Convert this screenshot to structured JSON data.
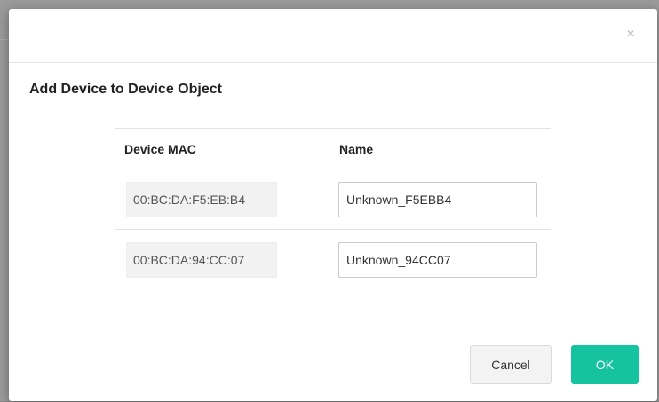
{
  "dialog": {
    "title": "Add Device to Device Object",
    "close_glyph": "×",
    "close_icon": "close-icon"
  },
  "table": {
    "headers": [
      "Device MAC",
      "Name"
    ],
    "rows": [
      {
        "mac": "00:BC:DA:F5:EB:B4",
        "name": "Unknown_F5EBB4"
      },
      {
        "mac": "00:BC:DA:94:CC:07",
        "name": "Unknown_94CC07"
      }
    ]
  },
  "buttons": {
    "cancel": "Cancel",
    "ok": "OK"
  },
  "colors": {
    "ok_button": "#16c3a0",
    "overlay": "#9a9a9a"
  }
}
